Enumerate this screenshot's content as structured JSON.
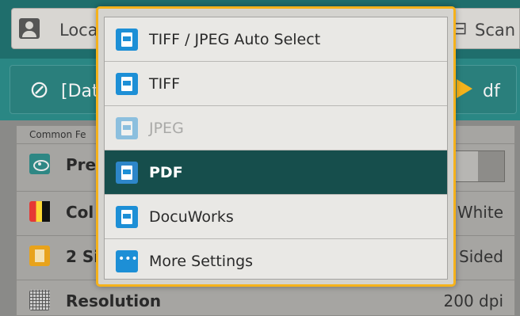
{
  "header": {
    "left_label": "Loca",
    "right_label": "Scan"
  },
  "destination": {
    "value": "[Dat",
    "right_fragment": "df"
  },
  "features": {
    "heading": "Common Fe",
    "rows": [
      {
        "label": "Pre",
        "value": ""
      },
      {
        "label": "Col",
        "value": "White"
      },
      {
        "label": "2 Si",
        "value": "Sided"
      },
      {
        "label": "Resolution",
        "value": "200 dpi"
      }
    ]
  },
  "file_format_menu": {
    "selected": "PDF",
    "items": [
      {
        "label": "TIFF / JPEG Auto Select",
        "icon": "tiff-jpeg-auto-icon",
        "state": "normal"
      },
      {
        "label": "TIFF",
        "icon": "tiff-file-icon",
        "state": "normal"
      },
      {
        "label": "JPEG",
        "icon": "jpeg-file-icon",
        "state": "disabled"
      },
      {
        "label": "PDF",
        "icon": "pdf-file-icon",
        "state": "selected"
      },
      {
        "label": "DocuWorks",
        "icon": "docuworks-file-icon",
        "state": "normal"
      },
      {
        "label": "More Settings",
        "icon": "more-dots-icon",
        "state": "normal"
      }
    ]
  },
  "colors": {
    "accent": "#f5b21b",
    "selected_bg": "#164e4c",
    "header_teal": "#1f6e6c",
    "icon_blue": "#1d8fd6"
  }
}
